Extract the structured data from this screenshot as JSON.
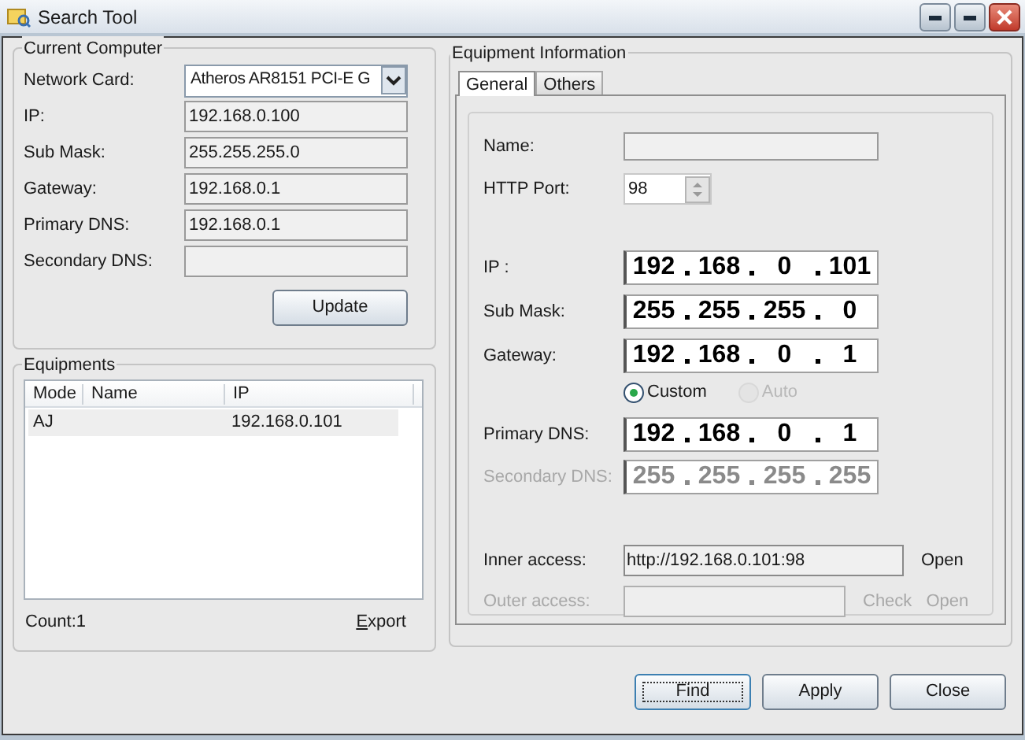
{
  "window": {
    "title": "Search Tool"
  },
  "current_computer": {
    "title": "Current Computer",
    "fields": [
      {
        "label": "Network Card:",
        "kind": "dropdown",
        "value": "Atheros AR8151 PCI-E G"
      },
      {
        "label": "IP:",
        "kind": "text",
        "value": "192.168.0.100"
      },
      {
        "label": "Sub Mask:",
        "kind": "text",
        "value": "255.255.255.0"
      },
      {
        "label": "Gateway:",
        "kind": "text",
        "value": "192.168.0.1"
      },
      {
        "label": "Primary DNS:",
        "kind": "text",
        "value": "192.168.0.1"
      },
      {
        "label": "Secondary DNS:",
        "kind": "text"
      }
    ],
    "update_button": "Update"
  },
  "equipments": {
    "title": "Equipments",
    "columns": [
      "Mode",
      "Name",
      "IP"
    ],
    "rows": [
      {
        "mode": "AJ",
        "ip": "192.168.0.101",
        "selected": true
      }
    ],
    "count": "Count:1",
    "export_button": "Export"
  },
  "equipment_information": {
    "title": "Equipment Information",
    "tabs": [
      {
        "label": "General",
        "selected": true
      },
      {
        "label": "Others",
        "selected": false
      }
    ],
    "name": {
      "label": "Name:"
    },
    "http_port": {
      "label": "HTTP Port:",
      "value": "98"
    },
    "address_fields": [
      {
        "label": "IP :",
        "octets": [
          "192",
          "168",
          "0",
          "101"
        ],
        "disabled": false
      },
      {
        "label": "Sub Mask:",
        "octets": [
          "255",
          "255",
          "255",
          "0"
        ],
        "disabled": false
      },
      {
        "label": "Gateway:",
        "octets": [
          "192",
          "168",
          "0",
          "1"
        ],
        "disabled": false
      }
    ],
    "dns_mode": [
      {
        "label": "Custom",
        "selected": true,
        "disabled": false
      },
      {
        "label": "Auto",
        "selected": false,
        "disabled": true
      }
    ],
    "dns_fields": [
      {
        "label": "Primary DNS:",
        "octets": [
          "192",
          "168",
          "0",
          "1"
        ],
        "disabled": false
      },
      {
        "label": "Secondary DNS:",
        "octets": [
          "255",
          "255",
          "255",
          "255"
        ],
        "disabled": true
      }
    ],
    "access": [
      {
        "label": "Inner access:",
        "value": "http://192.168.0.101:98",
        "disabled": false,
        "actions": [
          "Open"
        ]
      },
      {
        "label": "Outer access:",
        "disabled": true,
        "actions": [
          "Check",
          "Open"
        ]
      }
    ]
  },
  "buttons": [
    {
      "label": "Find",
      "focused": true
    },
    {
      "label": "Apply",
      "focused": false
    },
    {
      "label": "Close",
      "focused": false
    }
  ]
}
